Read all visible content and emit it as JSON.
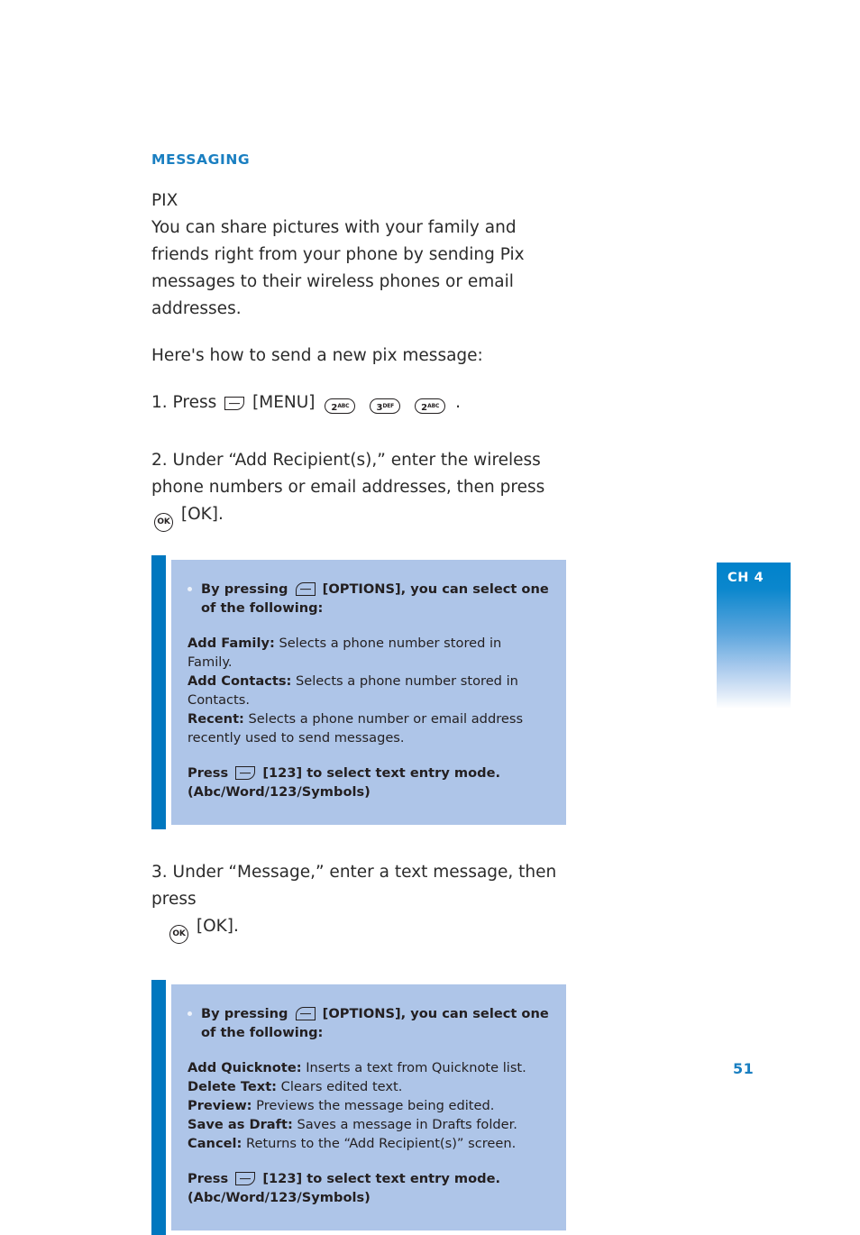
{
  "document": {
    "section_heading": "MESSAGING",
    "subheading": "PIX",
    "intro_paragraph": "You can share pictures with your family and friends right from your phone by sending Pix messages to their wireless phones or email addresses.",
    "lead_in": "Here's how to send a new pix message:",
    "page_number": "51",
    "chapter_tab": "CH 4",
    "colors": {
      "heading_blue": "#1a7fc1",
      "accent_bar_blue": "#0077bf",
      "callout_background": "#aec5e8",
      "body_text": "#2b2b2b",
      "tab_gradient_top": "#0082cb"
    }
  },
  "steps": {
    "step1": {
      "number": "1.",
      "press_label": "Press",
      "softkey_icon": "soft-key-right-icon",
      "menu_label": "[MENU]",
      "keys": [
        {
          "digit": "2",
          "letters": "ABC"
        },
        {
          "digit": "3",
          "letters": "DEF"
        },
        {
          "digit": "2",
          "letters": "ABC"
        }
      ],
      "period": "."
    },
    "step2": {
      "number": "2.",
      "text_before": "Under “Add Recipient(s),” enter the wireless phone numbers or email addresses, then press",
      "ok_icon_label": "OK",
      "text_after": "[OK]."
    },
    "step3": {
      "number": "3.",
      "text_before": "Under “Message,” enter a text message, then press",
      "ok_icon_label": "OK",
      "text_after": "[OK]."
    }
  },
  "callout1": {
    "bullet_text_1": "By pressing",
    "softkey_icon": "soft-key-left-icon",
    "bullet_text_2": "[OPTIONS], you can select one of the following:",
    "options": [
      {
        "term": "Add Family:",
        "desc": "Selects a phone number stored in Family."
      },
      {
        "term": "Add Contacts:",
        "desc": "Selects a phone number stored in Contacts."
      },
      {
        "term": "Recent:",
        "desc": "Selects a phone number or email address recently used to send messages."
      }
    ],
    "press_label": "Press",
    "press_softkey_icon": "soft-key-right-icon",
    "press_text": "[123] to select text entry mode.",
    "press_modes": "(Abc/Word/123/Symbols)"
  },
  "callout2": {
    "bullet_text_1": "By pressing",
    "softkey_icon": "soft-key-left-icon",
    "bullet_text_2": "[OPTIONS], you can select one of  the following:",
    "options": [
      {
        "term": "Add Quicknote:",
        "desc": "Inserts a text from Quicknote list."
      },
      {
        "term": "Delete Text:",
        "desc": "Clears edited text."
      },
      {
        "term": "Preview:",
        "desc": "Previews the message being edited."
      },
      {
        "term": "Save as Draft:",
        "desc": "Saves a message in Drafts folder."
      },
      {
        "term": "Cancel:",
        "desc": "Returns to the “Add Recipient(s)” screen."
      }
    ],
    "press_label": "Press",
    "press_softkey_icon": "soft-key-right-icon",
    "press_text": "[123] to select text entry mode.",
    "press_modes": "(Abc/Word/123/Symbols)"
  }
}
